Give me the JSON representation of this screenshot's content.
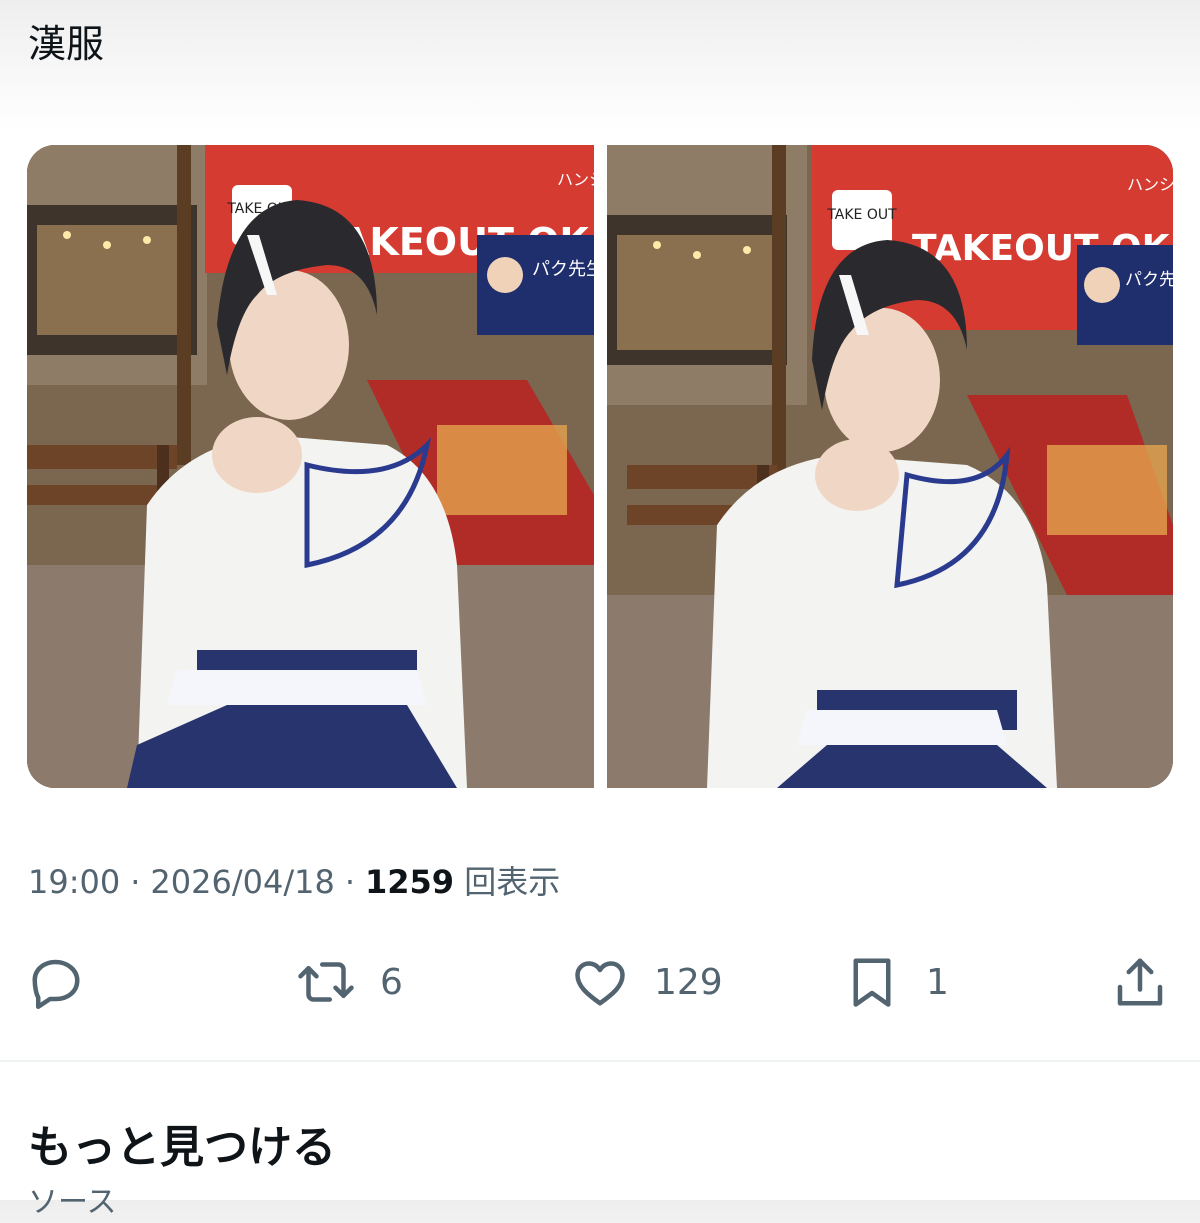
{
  "tweet": {
    "text": "漢服"
  },
  "media": [
    {
      "description": "Photo 1",
      "signs": {
        "takeout_badge": "TAKE OUT",
        "takeout_banner": "TAKEOUT OK",
        "poster_text": "パク先生",
        "banner_side_text": "ハンシグ"
      },
      "colors": {
        "shirt": "#f3f3f1",
        "skirt": "#27346e",
        "sash": "#f5f6fb",
        "banner_red": "#d63b32"
      }
    },
    {
      "description": "Photo 2",
      "signs": {
        "takeout_badge": "TAKE OUT",
        "takeout_banner": "TAKEOUT OK",
        "poster_text": "パク先生",
        "banner_side_text": "ハンシグ"
      },
      "colors": {
        "shirt": "#f3f3f1",
        "skirt": "#27346e",
        "sash": "#f5f6fb",
        "banner_red": "#d63b32"
      }
    }
  ],
  "meta": {
    "time": "19:00",
    "date": "2026/04/18",
    "views_count": "1259",
    "views_label": "回表示"
  },
  "actions": {
    "reply": {
      "icon": "reply-icon",
      "count": ""
    },
    "retweet": {
      "icon": "retweet-icon",
      "count": "6"
    },
    "like": {
      "icon": "heart-icon",
      "count": "129"
    },
    "bookmark": {
      "icon": "bookmark-icon",
      "count": "1"
    },
    "share": {
      "icon": "share-icon"
    }
  },
  "more": {
    "title": "もっと見つける",
    "subtitle": "ソース"
  },
  "colors": {
    "text_primary": "#0f1419",
    "text_secondary": "#536471",
    "divider": "#eff3f4"
  }
}
